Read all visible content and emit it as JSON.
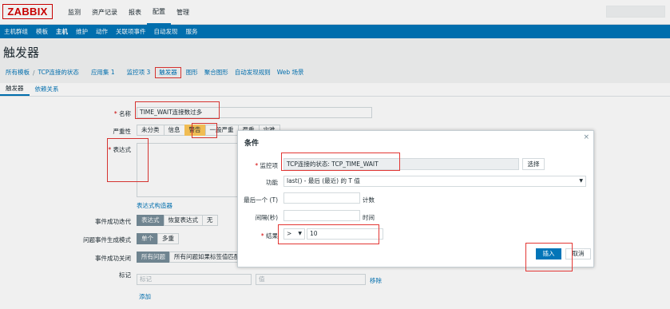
{
  "header": {
    "logo": "ZABBIX",
    "nav": [
      "监测",
      "资产记录",
      "报表",
      "配置",
      "管理"
    ]
  },
  "subnav": [
    "主机群组",
    "模板",
    "主机",
    "维护",
    "动作",
    "关联项事件",
    "自动发现",
    "服务"
  ],
  "page_title": "触发器",
  "breadcrumb": {
    "all_templates": "所有模板",
    "template": "TCP连接的状态",
    "items": [
      "应用集 1",
      "监控项 3",
      "触发器",
      "图形",
      "聚合图形",
      "自动发现规则",
      "Web 场景"
    ]
  },
  "tabs": [
    "触发器",
    "依赖关系"
  ],
  "form": {
    "name_label": "名称",
    "name_value": "TIME_WAIT连接数过多",
    "severity_label": "严重性",
    "severity_options": [
      "未分类",
      "信息",
      "警告",
      "一般严重",
      "严重",
      "灾难"
    ],
    "expression_label": "表达式",
    "expression_constructor": "表达式构造器",
    "event_gen_label": "事件成功迭代",
    "event_gen_options": [
      "表达式",
      "恢复表达式",
      "无"
    ],
    "problem_mode_label": "问题事件生成模式",
    "problem_mode_options": [
      "单个",
      "多重"
    ],
    "ok_close_label": "事件成功关闭",
    "ok_close_options": [
      "所有问题",
      "所有问题如果标签值匹配"
    ],
    "tags_label": "标记",
    "tag_placeholder": "标记",
    "value_placeholder": "值",
    "remove_link": "移除",
    "add_link": "添加"
  },
  "dialog": {
    "title": "条件",
    "close_symbol": "×",
    "item_label": "监控项",
    "item_value": "TCP连接的状态: TCP_TIME_WAIT",
    "select_button": "选择",
    "function_label": "功能",
    "function_value": "last() - 最后 (最近) 的 T 值",
    "last_of_label": "最后一个 (T)",
    "last_of_unit": "计数",
    "time_shift_label": "间隔(秒)",
    "time_shift_unit": "时间",
    "result_label": "结果",
    "result_operator": ">",
    "result_value": "10",
    "insert_button": "插入",
    "cancel_button": "取消"
  },
  "colors": {
    "brand_red": "#d40000",
    "primary_blue": "#0275b8",
    "warning_yellow": "#ffc859",
    "annotation_red": "#e33734"
  }
}
